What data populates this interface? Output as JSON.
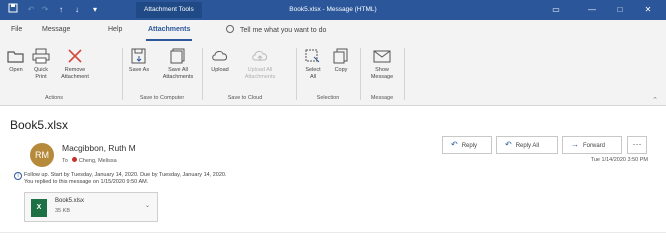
{
  "titlebar": {
    "context_tab": "Attachment Tools",
    "title": "Book5.xlsx - Message (HTML)",
    "minimize": "—",
    "maximize": "□",
    "close": "✕",
    "ribbon_display": "▭"
  },
  "quick_access": {
    "save_icon": "save-icon",
    "up": "↑",
    "down": "↓",
    "dropdown": "▾"
  },
  "tabs": [
    "File",
    "Message",
    "Help",
    "Attachments"
  ],
  "active_tab": "Attachments",
  "tell_me": "Tell me what you want to do",
  "ribbon": {
    "actions": {
      "group": "Actions",
      "buttons": [
        {
          "label": "Open",
          "icon": "folder-open-icon"
        },
        {
          "label": "Quick Print",
          "icon": "printer-icon"
        },
        {
          "label": "Remove Attachment",
          "icon": "remove-x-icon"
        }
      ]
    },
    "save_to_computer": {
      "group": "Save to Computer",
      "buttons": [
        {
          "label": "Save As",
          "icon": "save-as-icon"
        },
        {
          "label": "Save All Attachments",
          "icon": "save-all-icon"
        }
      ]
    },
    "save_to_cloud": {
      "group": "Save to Cloud",
      "buttons": [
        {
          "label": "Upload",
          "icon": "cloud-upload-icon"
        },
        {
          "label": "Upload All Attachments",
          "icon": "cloud-upload-all-icon"
        }
      ]
    },
    "selection": {
      "group": "Selection",
      "buttons": [
        {
          "label": "Select All",
          "icon": "select-all-icon"
        },
        {
          "label": "Copy",
          "icon": "copy-icon"
        }
      ]
    },
    "message": {
      "group": "Message",
      "buttons": [
        {
          "label": "Show Message",
          "icon": "envelope-icon"
        }
      ]
    }
  },
  "email": {
    "subject": "Book5.xlsx",
    "sender_initials": "RM",
    "sender": "Macgibbon, Ruth M",
    "to_label": "To",
    "recipient": "Cheng, Melissa",
    "reply": "Reply",
    "reply_all": "Reply All",
    "forward": "Forward",
    "more": "···",
    "date": "Tue 1/14/2020 3:50 PM",
    "followup_line1": "Follow up.  Start by Tuesday, January 14, 2020.  Due by Tuesday, January 14, 2020.",
    "followup_line2": "You replied to this message on 1/15/2020 9:50 AM.",
    "attachment": {
      "name": "Book5.xlsx",
      "size": "35 KB",
      "icon": "excel-file-icon"
    }
  },
  "colors": {
    "accent": "#2b579a",
    "ribbon_bg": "#f3f3f3",
    "avatar": "#b58a3b",
    "excel": "#1e7145",
    "flag_dot": "#c7312a"
  }
}
